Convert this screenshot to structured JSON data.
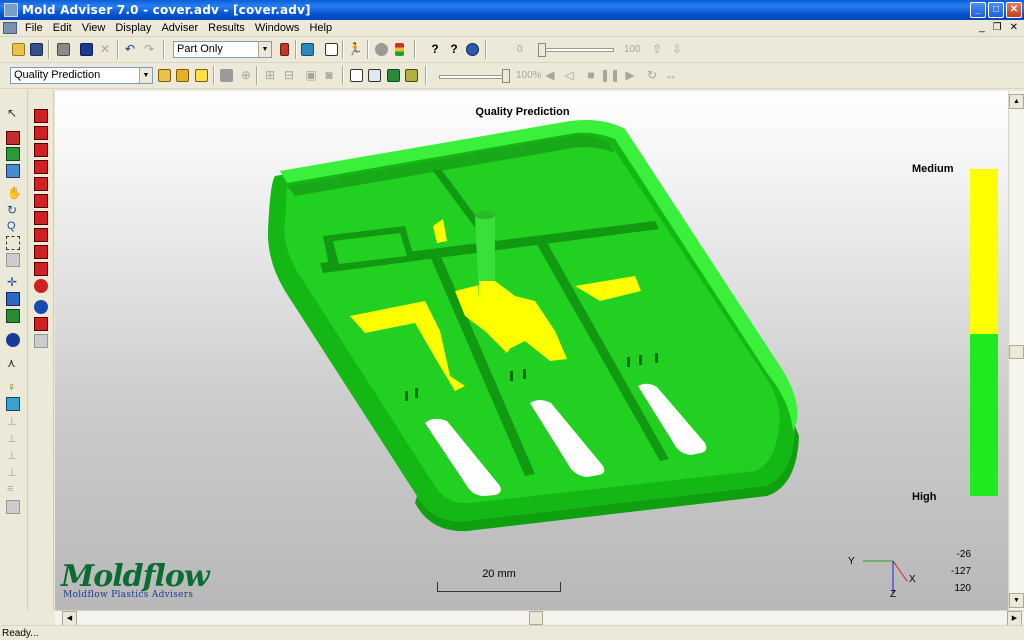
{
  "window": {
    "title": "Mold Adviser 7.0 - cover.adv - [cover.adv]",
    "controls": {
      "minimize": "_",
      "maximize": "□",
      "close": "✕"
    }
  },
  "menubar": {
    "items": [
      "File",
      "Edit",
      "View",
      "Display",
      "Adviser",
      "Results",
      "Windows",
      "Help"
    ],
    "mdi_controls": {
      "minimize": "_",
      "restore": "❐",
      "close": "✕"
    }
  },
  "toolbar1": {
    "view_select": "Part Only",
    "slider_min": "0",
    "slider_max": "100"
  },
  "toolbar2": {
    "result_select": "Quality Prediction",
    "percent_label": "100%"
  },
  "viewport": {
    "title": "Quality Prediction",
    "legend": {
      "top_label": "Medium",
      "bottom_label": "High",
      "top_color": "#ffff00",
      "bottom_color": "#1eea1e"
    },
    "scale_label": "20 mm",
    "triad": {
      "y": "Y",
      "x": "X",
      "z": "Z"
    },
    "coords": [
      "-26",
      "-127",
      "120"
    ],
    "logo": {
      "wordmark": "Moldflow",
      "subtitle": "Moldflow Plastics Advisers"
    }
  },
  "status": {
    "text": "Ready..."
  },
  "colors": {
    "part_green": "#1fd01f",
    "part_yellow": "#ffff00",
    "title_blue": "#0553d0"
  }
}
